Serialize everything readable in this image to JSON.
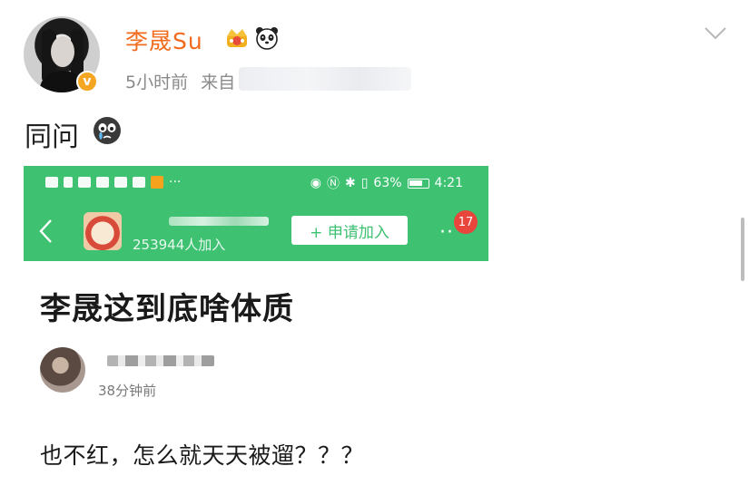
{
  "post": {
    "username": "李晟Su",
    "time": "5小时前",
    "source_prefix": "来自",
    "text": "同问",
    "emoji": "crying-emoji"
  },
  "screenshot": {
    "status_bar": {
      "right_text": "63%",
      "time": "4:21"
    },
    "group": {
      "member_count": "253944人加入",
      "join_button": "+ 申请加入",
      "notification_count": "17"
    },
    "article": {
      "title": "李晟这到底啥体质",
      "post_time": "38分钟前",
      "body": "也不红，怎么就天天被遛？？？"
    }
  },
  "icons": {
    "verified": "verified-badge-icon",
    "crown": "crown-icon",
    "panda": "panda-icon",
    "chevron": "chevron-down-icon",
    "back": "back-arrow-icon"
  },
  "colors": {
    "username": "#f26b1d",
    "app_green": "#3ec272",
    "badge_red": "#e8453c",
    "verified_orange": "#f4a623"
  }
}
